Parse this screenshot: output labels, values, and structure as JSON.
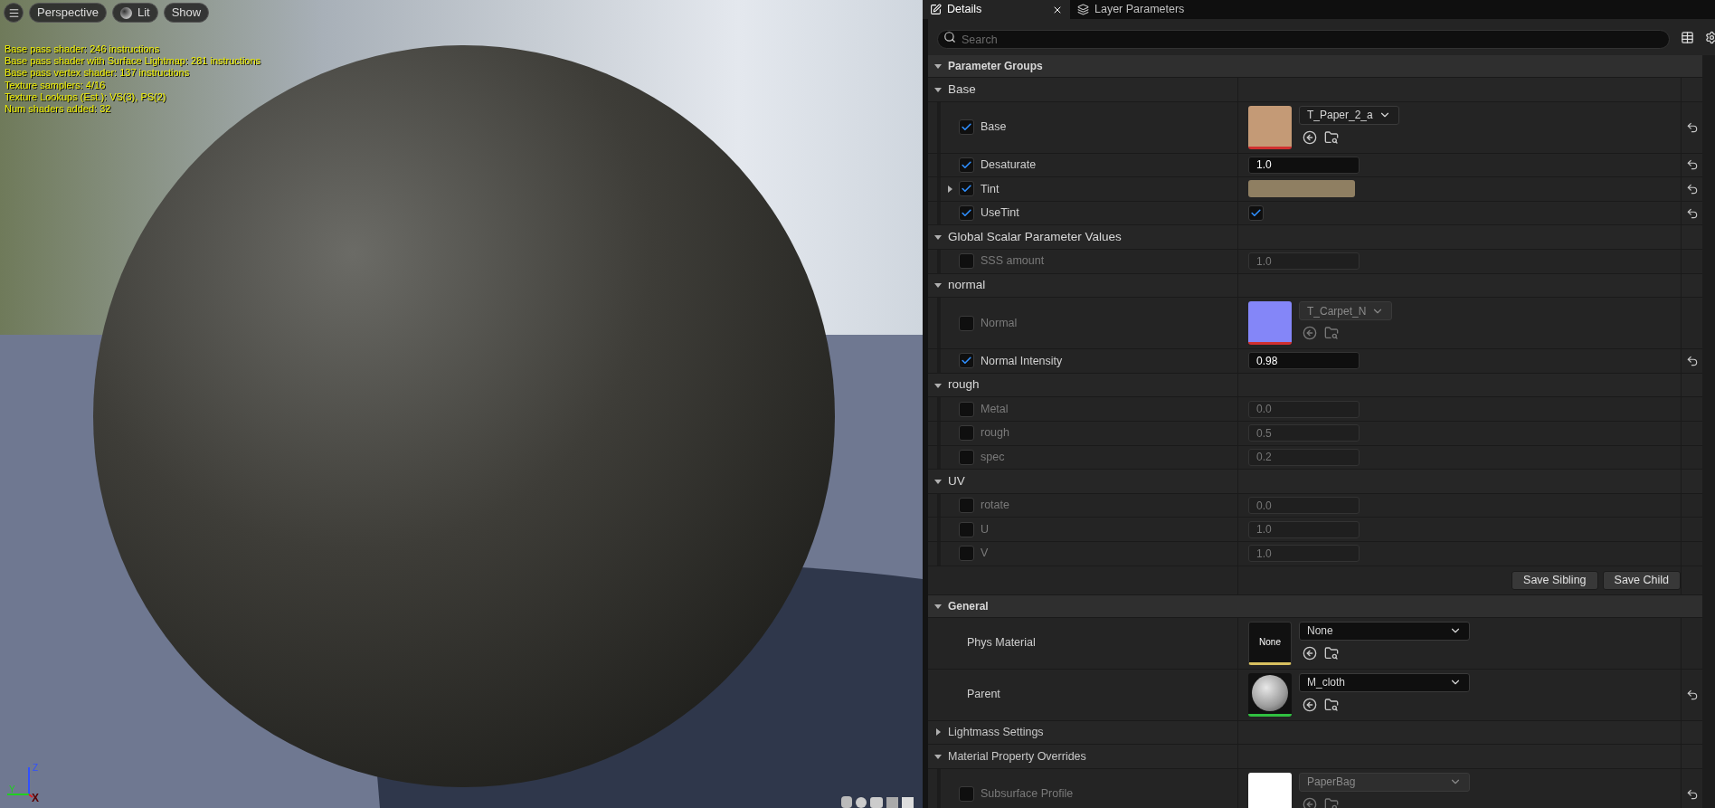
{
  "viewport": {
    "toolbar": [
      {
        "kind": "menu"
      },
      {
        "kind": "text",
        "label": "Perspective"
      },
      {
        "kind": "lit",
        "label": "Lit"
      },
      {
        "kind": "text",
        "label": "Show"
      }
    ],
    "stats": [
      "Base pass shader: 246 instructions",
      "Base pass shader with Surface Lightmap: 281 instructions",
      "Base pass vertex shader: 137 instructions",
      "Texture samplers: 4/16",
      "Texture Lookups (Est.): VS(3), PS(2)",
      "Num shaders added: 32"
    ],
    "axes": [
      "Z",
      "Y",
      "X"
    ]
  },
  "details": {
    "tabs": [
      {
        "label": "Details",
        "selected": true,
        "closable": true
      },
      {
        "label": "Layer Parameters",
        "selected": false,
        "closable": false
      }
    ],
    "search": {
      "placeholder": "Search"
    },
    "categories": [
      {
        "title": "Parameter Groups",
        "expanded": true,
        "groups": [
          {
            "title": "Base",
            "expanded": true,
            "params": [
              {
                "kind": "texture",
                "name": "Base",
                "enabled": true,
                "asset": "T_Paper_2_a",
                "color": "#c49a76",
                "modified": true
              },
              {
                "kind": "scalar",
                "name": "Desaturate",
                "enabled": true,
                "value": "1.0",
                "modified": true
              },
              {
                "kind": "color",
                "name": "Tint",
                "enabled": true,
                "expanded": false,
                "color": "#8f7f62",
                "modified": true
              },
              {
                "kind": "bool",
                "name": "UseTint",
                "enabled": true,
                "checked": true,
                "modified": true
              }
            ]
          },
          {
            "title": "Global Scalar Parameter Values",
            "expanded": true,
            "params": [
              {
                "kind": "scalar",
                "name": "SSS amount",
                "enabled": false,
                "value": "1.0",
                "modified": false
              }
            ]
          },
          {
            "title": "normal",
            "expanded": true,
            "params": [
              {
                "kind": "texture",
                "name": "Normal",
                "enabled": false,
                "asset": "T_Carpet_N",
                "color": "#8486f8",
                "modified": false
              },
              {
                "kind": "scalar",
                "name": "Normal Intensity",
                "enabled": true,
                "value": "0.98",
                "modified": true
              }
            ]
          },
          {
            "title": "rough",
            "expanded": true,
            "params": [
              {
                "kind": "scalar",
                "name": "Metal",
                "enabled": false,
                "value": "0.0",
                "modified": false
              },
              {
                "kind": "scalar",
                "name": "rough",
                "enabled": false,
                "value": "0.5",
                "modified": false
              },
              {
                "kind": "scalar",
                "name": "spec",
                "enabled": false,
                "value": "0.2",
                "modified": false
              }
            ]
          },
          {
            "title": "UV",
            "expanded": true,
            "params": [
              {
                "kind": "scalar",
                "name": "rotate",
                "enabled": false,
                "value": "0.0",
                "modified": false
              },
              {
                "kind": "scalar",
                "name": "U",
                "enabled": false,
                "value": "1.0",
                "modified": false
              },
              {
                "kind": "scalar",
                "name": "V",
                "enabled": false,
                "value": "1.0",
                "modified": false
              }
            ]
          }
        ],
        "buttons": [
          "Save Sibling",
          "Save Child"
        ]
      },
      {
        "title": "General",
        "expanded": true,
        "properties": [
          {
            "kind": "physmat",
            "name": "Phys Material",
            "asset": "None",
            "thumb_label": "None",
            "modified": false
          },
          {
            "kind": "material",
            "name": "Parent",
            "asset": "M_cloth",
            "modified": true
          }
        ],
        "groups": [
          {
            "title": "Lightmass Settings",
            "expanded": false
          },
          {
            "title": "Material Property Overrides",
            "expanded": true,
            "params": [
              {
                "kind": "texture",
                "name": "Subsurface Profile",
                "enabled": false,
                "asset": "PaperBag",
                "color": "#ffffff",
                "modified": true
              }
            ]
          }
        ]
      }
    ]
  }
}
